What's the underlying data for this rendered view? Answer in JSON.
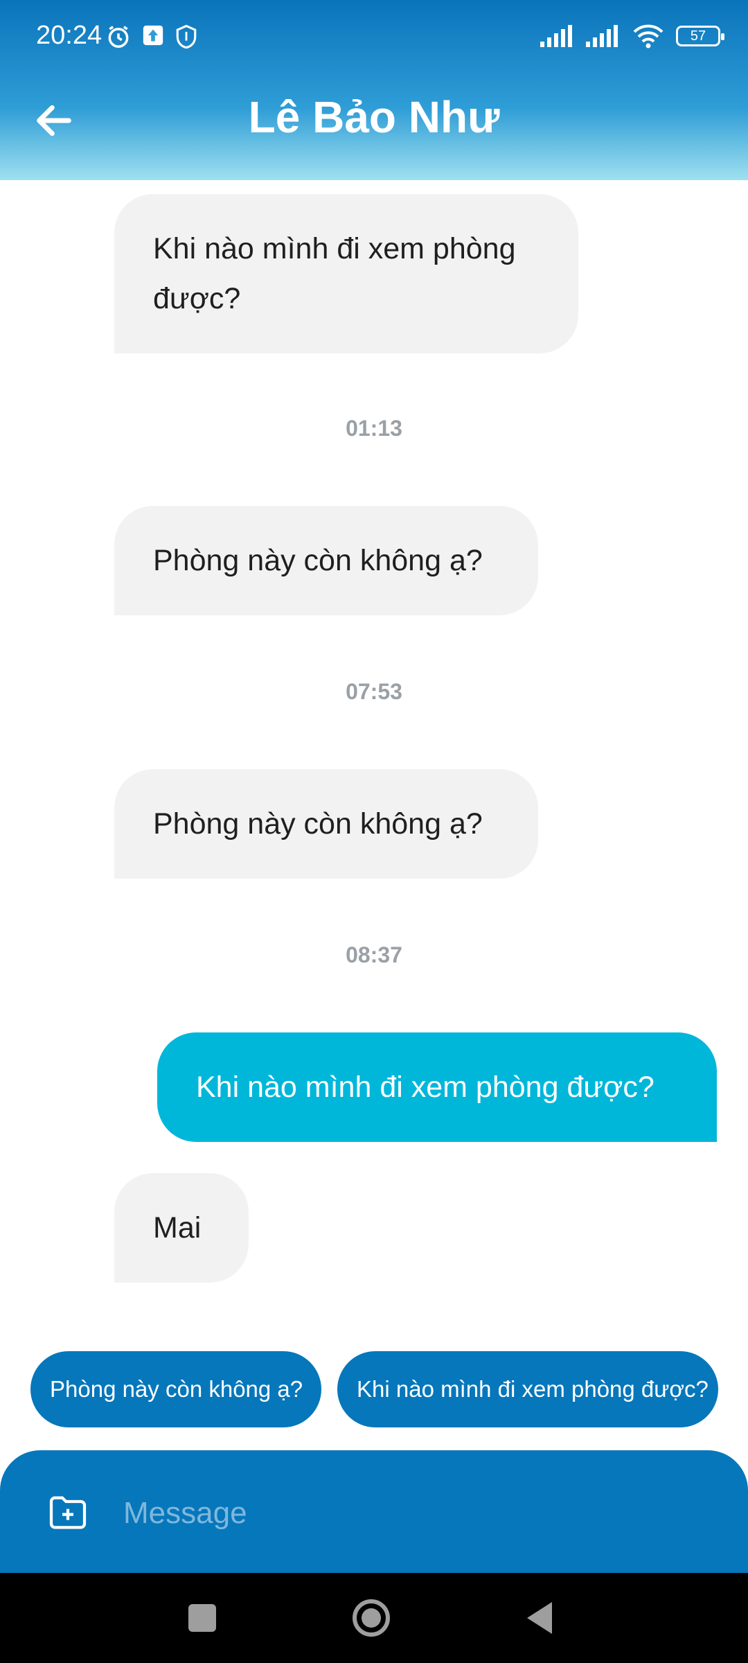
{
  "status_bar": {
    "time": "20:24",
    "battery": "57",
    "icons": [
      "alarm-icon",
      "upload-icon",
      "shield-icon",
      "signal-icon",
      "signal-icon",
      "wifi-icon",
      "battery-icon"
    ]
  },
  "header": {
    "title": "Lê Bảo Như",
    "back_icon": "arrow-left-icon"
  },
  "messages": [
    {
      "type": "in",
      "text": "Khi nào mình đi xem phòng được?"
    },
    {
      "type": "time",
      "text": "01:13"
    },
    {
      "type": "in",
      "text": "Phòng này còn không ạ?"
    },
    {
      "type": "time",
      "text": "07:53"
    },
    {
      "type": "in",
      "text": "Phòng này còn không ạ?"
    },
    {
      "type": "time",
      "text": "08:37"
    },
    {
      "type": "out",
      "text": "Khi nào mình đi xem phòng được?"
    },
    {
      "type": "in",
      "text": "Mai"
    }
  ],
  "suggestions": [
    "Phòng này còn không ạ?",
    "Khi nào mình đi xem phòng được?"
  ],
  "composer": {
    "placeholder": "Message",
    "attach_icon": "folder-plus-icon"
  },
  "colors": {
    "header_gradient_top": "#0a74bb",
    "header_gradient_bottom": "#9fe1f0",
    "outgoing_bubble": "#00b7da",
    "incoming_bubble": "#f2f2f2",
    "chip": "#0677bb",
    "composer": "#0677bb",
    "timestamp": "#9aa0a6"
  }
}
